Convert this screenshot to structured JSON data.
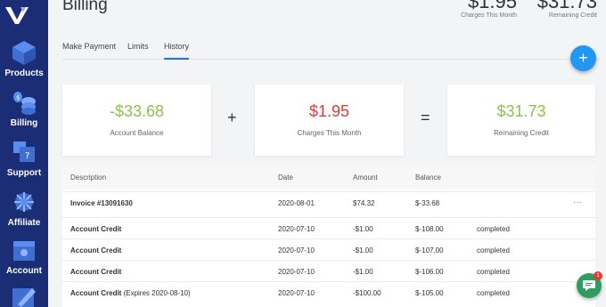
{
  "sidebar": {
    "items": [
      {
        "label": "Products",
        "icon": "cube-icon"
      },
      {
        "label": "Billing",
        "icon": "coins-icon"
      },
      {
        "label": "Support",
        "icon": "support-icon"
      },
      {
        "label": "Affiliate",
        "icon": "affiliate-icon"
      },
      {
        "label": "Account",
        "icon": "account-icon"
      }
    ]
  },
  "header": {
    "title": "Billing",
    "charges_value": "$1.95",
    "charges_label": "Charges This Month",
    "remaining_value": "$31.73",
    "remaining_label": "Remaining Credit"
  },
  "tabs": [
    {
      "label": "Make Payment"
    },
    {
      "label": "Limits"
    },
    {
      "label": "History"
    }
  ],
  "fab": {
    "label": "+"
  },
  "cards": {
    "balance": {
      "value": "-$33.68",
      "label": "Account Balance",
      "color": "#8bc34a"
    },
    "charges": {
      "value": "$1.95",
      "label": "Charges This Month",
      "color": "#e53935"
    },
    "remaining": {
      "value": "$31.73",
      "label": "Remaining Credit",
      "color": "#8bc34a"
    },
    "plus": "+",
    "equals": "="
  },
  "table": {
    "headers": {
      "description": "Description",
      "date": "Date",
      "amount": "Amount",
      "balance": "Balance"
    },
    "rows": [
      {
        "description": "Invoice #13091630",
        "extra": "",
        "date": "2020-08-01",
        "amount": "$74.32",
        "balance": "$-33.68",
        "status": ""
      },
      {
        "description": "Account Credit",
        "extra": "",
        "date": "2020-07-10",
        "amount": "-$1.00",
        "balance": "$-108.00",
        "status": "completed"
      },
      {
        "description": "Account Credit",
        "extra": "",
        "date": "2020-07-10",
        "amount": "-$1.00",
        "balance": "$-107.00",
        "status": "completed"
      },
      {
        "description": "Account Credit",
        "extra": "",
        "date": "2020-07-10",
        "amount": "-$1.00",
        "balance": "$-106.00",
        "status": "completed"
      },
      {
        "description": "Account Credit",
        "extra": " (Expires 2020-08-10)",
        "date": "2020-07-10",
        "amount": "-$100.00",
        "balance": "$-105.00",
        "status": "completed"
      }
    ],
    "more": "···"
  },
  "chat": {
    "badge": "1"
  }
}
